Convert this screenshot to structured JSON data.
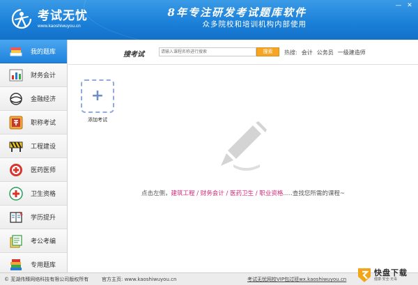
{
  "header": {
    "app_name": "考试无忧",
    "app_domain": "www.kaoshiwuyou.cn",
    "slogan_main": "8年专注研发考试题库软件",
    "slogan_sub": "众多院校和培训机构内部使用",
    "window_controls": [
      "minimize-icon",
      "close-icon"
    ]
  },
  "sidebar": {
    "items": [
      {
        "label": "我的题库",
        "icon": "book-stack-icon",
        "active": true
      },
      {
        "label": "财务会计",
        "icon": "bar-chart-icon"
      },
      {
        "label": "金融经济",
        "icon": "globe-icon"
      },
      {
        "label": "职称考试",
        "icon": "exam-stamp-icon"
      },
      {
        "label": "工程建设",
        "icon": "barrier-icon"
      },
      {
        "label": "医药医师",
        "icon": "medical-cross-icon"
      },
      {
        "label": "卫生资格",
        "icon": "health-cross-icon"
      },
      {
        "label": "学历提升",
        "icon": "open-book-icon"
      },
      {
        "label": "考公考编",
        "icon": "documents-icon"
      },
      {
        "label": "专用题库",
        "icon": "book-pile-icon"
      }
    ]
  },
  "search": {
    "title": "搜考试",
    "placeholder": "请输入课程名称进行搜索",
    "button_label": "搜索",
    "hot_label": "热搜:",
    "hot_tags": [
      "会计",
      "公务员",
      "一级建造师"
    ]
  },
  "main": {
    "add_exam_label": "添加考试",
    "hint_prefix": "点击左侧，",
    "hint_categories": "建筑工程 / 财务会计 / 医药卫生 / 职业资格",
    "hint_suffix": ".....查找您所需的课程~"
  },
  "footer": {
    "copyright": "© 芜湖伟臻网络科技有限公司版权所有",
    "homepage": "官方主页: www.kaoshiwuyou.cn",
    "vip_link": "考试无忧网校VIP包过班wx.kaoshiwuyou.cn"
  },
  "watermark": {
    "name": "快盘下载",
    "tagline": "健康·安全·无毒"
  },
  "colors": {
    "header_blue": "#1a7fd8",
    "sidebar_active": "#1f82dc",
    "search_button": "#f5a623",
    "hint_category": "#d4237a"
  }
}
